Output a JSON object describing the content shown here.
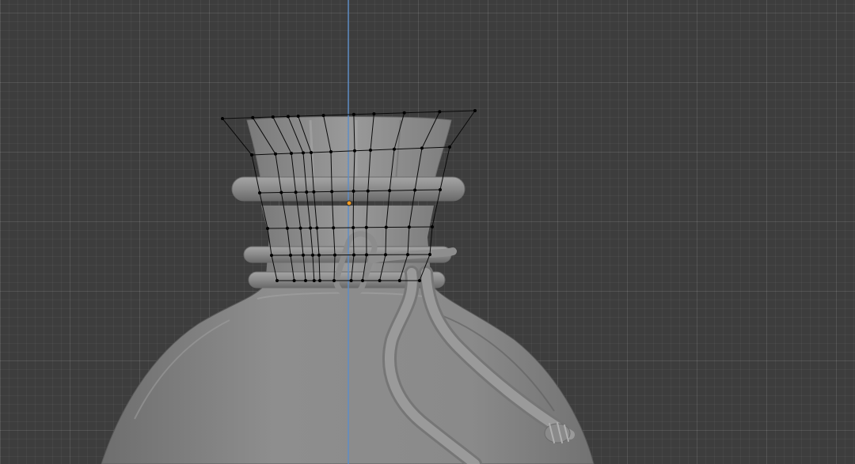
{
  "viewport": {
    "mode": "edit",
    "view": "front-orthographic",
    "colors": {
      "background": "#3d3d3d",
      "grid": "#4a4a4a",
      "z_axis": "#5b8dc9",
      "mesh_fill": "#8f8f8f",
      "wire": "#0a0a0a",
      "vertex": "#000000",
      "origin": "#f29a1f"
    },
    "objects": [
      {
        "name": "bottle-body",
        "shading": "solid",
        "xray": true
      },
      {
        "name": "rope",
        "shading": "solid",
        "xray": true
      },
      {
        "name": "edit-cage",
        "state": "selected-edit-mesh"
      }
    ]
  }
}
